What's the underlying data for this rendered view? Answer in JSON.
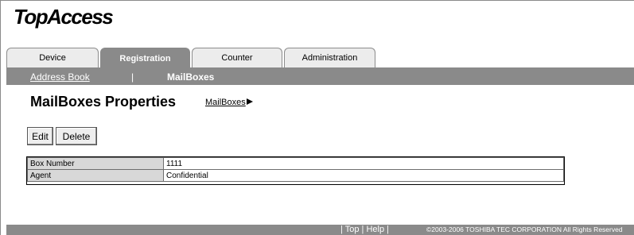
{
  "app": {
    "logo": "TopAccess"
  },
  "tabs": [
    {
      "label": "Device"
    },
    {
      "label": "Registration"
    },
    {
      "label": "Counter"
    },
    {
      "label": "Administration"
    }
  ],
  "subnav": {
    "link": "Address Book",
    "separator": "|",
    "current": "MailBoxes"
  },
  "page": {
    "title": "MailBoxes Properties",
    "breadcrumb": "MailBoxes"
  },
  "buttons": {
    "edit": "Edit",
    "delete": "Delete"
  },
  "properties": [
    {
      "label": "Box Number",
      "value": "1111"
    },
    {
      "label": "Agent",
      "value": "Confidential"
    }
  ],
  "footer": {
    "sep1": "|",
    "top": "Top",
    "sep2": "|",
    "help": "Help",
    "sep3": "|",
    "copyright": "©2003-2006 TOSHIBA TEC CORPORATION All Rights Reserved"
  },
  "colors": {
    "bar": "#8a8a8a",
    "tab_inactive": "#ececec",
    "label_cell": "#d8d8d8"
  }
}
